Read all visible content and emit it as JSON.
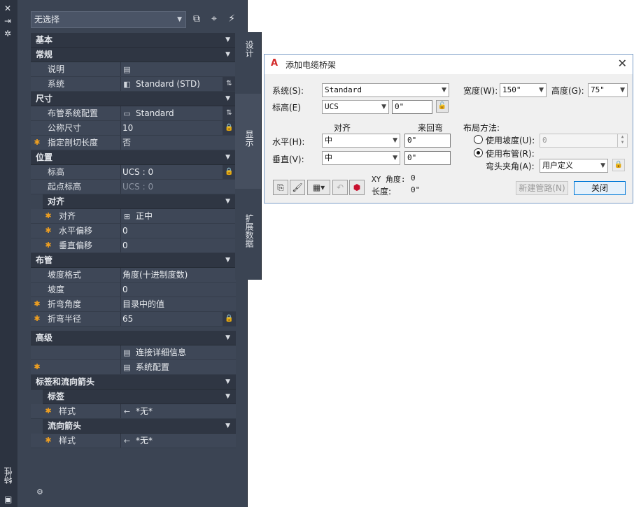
{
  "palette": {
    "title": "特性",
    "selector": "无选择",
    "tabs": {
      "design": "设计",
      "display": "显示",
      "extended": "扩展数据"
    },
    "sections": {
      "basic": "基本",
      "general": "常规",
      "description": "说明",
      "system_label": "系统",
      "system_value": "Standard (STD)",
      "dimension": "尺寸",
      "routing_pref": "布管系统配置",
      "routing_pref_value": "Standard",
      "nominal_size": "公称尺寸",
      "nominal_size_value": "10",
      "cut_length": "指定剖切长度",
      "cut_length_value": "否",
      "location": "位置",
      "elevation": "标高",
      "elevation_value": "UCS : 0",
      "start_elevation": "起点标高",
      "start_elevation_value": "UCS : 0",
      "justification_group": "对齐",
      "justification": "对齐",
      "justification_value": "正中",
      "h_offset": "水平偏移",
      "h_offset_value": "0",
      "v_offset": "垂直偏移",
      "v_offset_value": "0",
      "routing": "布管",
      "slope_format": "坡度格式",
      "slope_format_value": "角度(十进制度数)",
      "slope": "坡度",
      "slope_value": "0",
      "bend_angle": "折弯角度",
      "bend_angle_value": "目录中的值",
      "bend_radius": "折弯半径",
      "bend_radius_value": "65",
      "advanced": "高级",
      "connection_details": "连接详细信息",
      "system_config": "系统配置",
      "tags_arrows": "标签和流向箭头",
      "tag": "标签",
      "tag_style": "样式",
      "tag_style_value": "*无*",
      "flow_arrow": "流向箭头",
      "arrow_style": "样式",
      "arrow_style_value": "*无*"
    }
  },
  "dialog": {
    "title": "添加电缆桥架",
    "system_label": "系统(S):",
    "system_value": "Standard",
    "elevation_label": "标高(E)",
    "elevation_ucs": "UCS",
    "elevation_value": "0\"",
    "width_label": "宽度(W):",
    "width_value": "150\"",
    "height_label": "高度(G):",
    "height_value": "75\"",
    "justification_header": "对齐",
    "return_header": "来回弯",
    "horizontal_label": "水平(H):",
    "horizontal_value": "中",
    "horizontal_offset": "0\"",
    "vertical_label": "垂直(V):",
    "vertical_value": "中",
    "vertical_offset": "0\"",
    "layout_method_label": "布局方法:",
    "use_slope_label": "使用坡度(U):",
    "use_slope_value": "0",
    "use_routing_label": "使用布管(R):",
    "elbow_angle_label": "弯头夹角(A):",
    "elbow_angle_value": "用户定义",
    "xy_angle_label": "XY 角度:",
    "xy_angle_value": "0",
    "length_label": "长度:",
    "length_value": "0\"",
    "new_run_button": "新建管路(N)",
    "close_button": "关闭"
  }
}
